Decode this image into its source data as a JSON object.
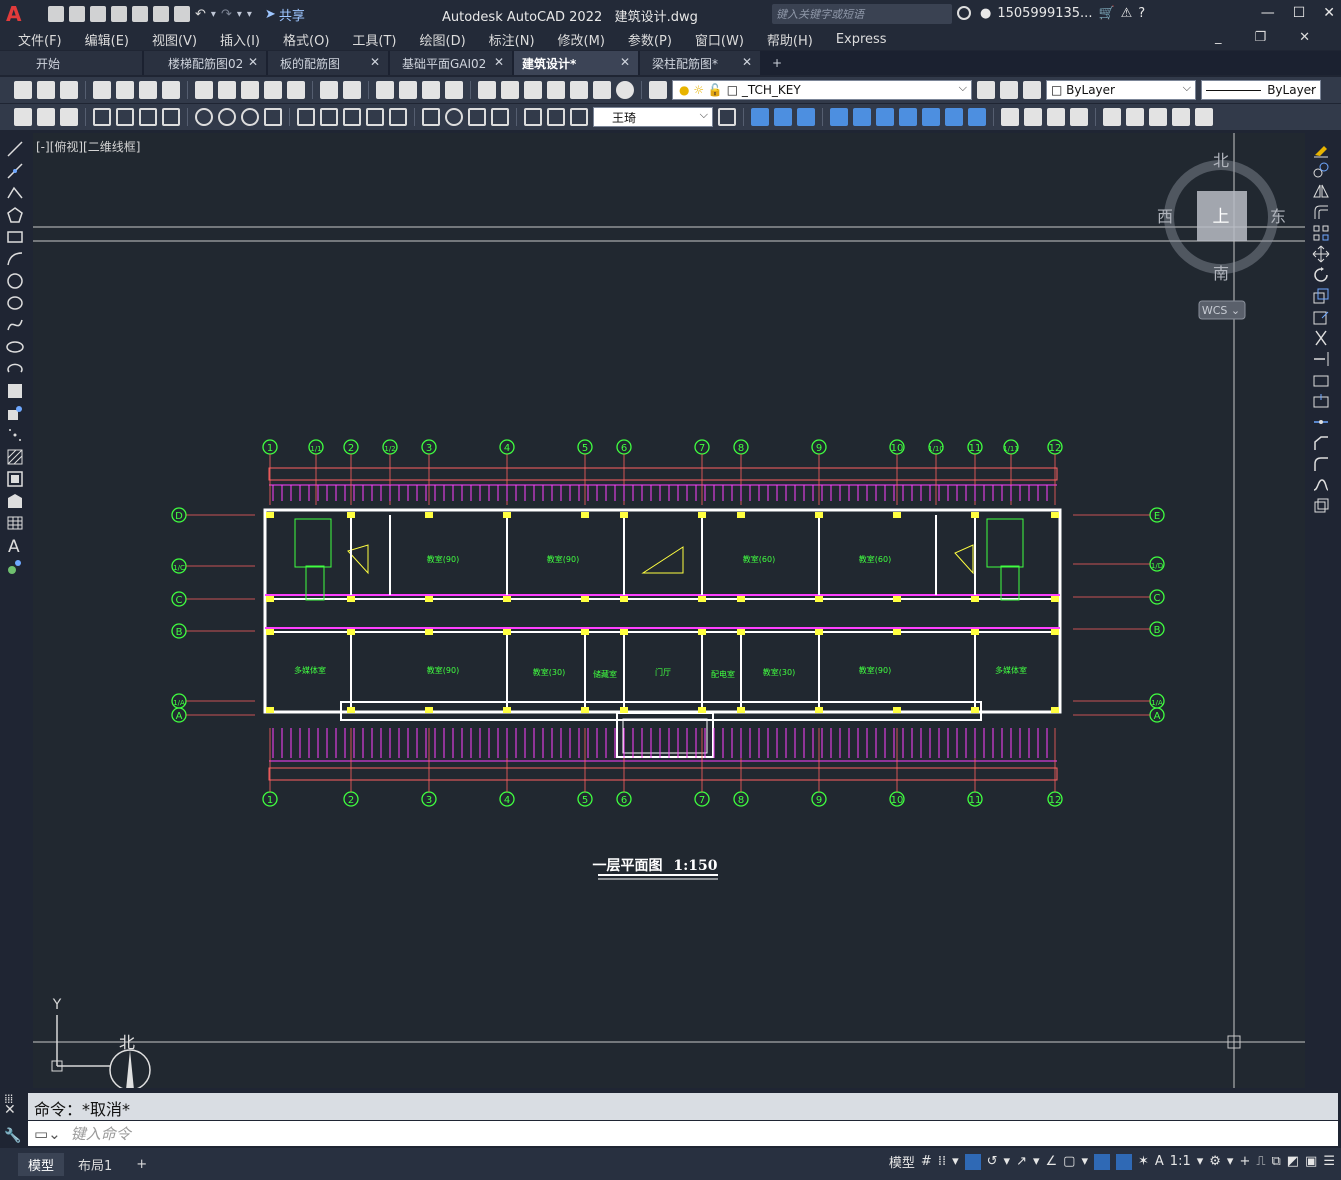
{
  "app": {
    "logo": "A",
    "title": "Autodesk AutoCAD 2022",
    "file": "建筑设计.dwg",
    "share_label": "共享",
    "search_placeholder": "键入关键字或短语",
    "user": "1505999135...",
    "colors": {
      "accent": "#2f69b5",
      "canvas": "#212830",
      "logo": "#e23b3b"
    }
  },
  "menu": [
    "文件(F)",
    "编辑(E)",
    "视图(V)",
    "插入(I)",
    "格式(O)",
    "工具(T)",
    "绘图(D)",
    "标注(N)",
    "修改(M)",
    "参数(P)",
    "窗口(W)",
    "帮助(H)",
    "Express"
  ],
  "tabs": [
    {
      "label": "开始",
      "active": false
    },
    {
      "label": "楼梯配筋图02",
      "active": false
    },
    {
      "label": "板的配筋图",
      "active": false
    },
    {
      "label": "基础平面GAI02",
      "active": false
    },
    {
      "label": "建筑设计*",
      "active": true
    },
    {
      "label": "梁柱配筋图*",
      "active": false
    }
  ],
  "toolbar": {
    "layer_name": "_TCH_KEY",
    "color": "ByLayer",
    "linetype": "ByLayer",
    "text_style": "王琦"
  },
  "viewport": {
    "label": "[-][俯视][二维线框]",
    "compass": {
      "north": "北",
      "south": "南",
      "east": "东",
      "west": "西",
      "top": "上"
    },
    "wcs": "WCS ⌄",
    "ucs_y": "Y"
  },
  "drawing": {
    "title": "一层平面图",
    "scale": "1:150",
    "axes_top": [
      "1",
      "1/1",
      "2",
      "1/2",
      "3",
      "4",
      "5",
      "6",
      "7",
      "8",
      "9",
      "10",
      "1/10",
      "11",
      "1/11",
      "12"
    ],
    "axes_bottom": [
      "1",
      "2",
      "3",
      "4",
      "5",
      "6",
      "7",
      "8",
      "9",
      "10",
      "11",
      "12"
    ],
    "axes_left": [
      "D",
      "1/C",
      "C",
      "B",
      "1/A",
      "A"
    ],
    "axes_right": [
      "E",
      "1/D",
      "C",
      "B",
      "1/A",
      "A"
    ],
    "rooms": [
      "教室(90)",
      "教室(90)",
      "教室(60)",
      "教室(60)",
      "多媒体室",
      "教室(90)",
      "教室(30)",
      "储藏室",
      "门厅",
      "配电室",
      "教室(30)",
      "教室(90)",
      "多媒体室"
    ]
  },
  "command": {
    "history": "命令：*取消*",
    "placeholder": "键入命令"
  },
  "layouts": {
    "model": "模型",
    "layout1": "布局1"
  },
  "status": {
    "model": "模型",
    "scale": "1:1"
  }
}
